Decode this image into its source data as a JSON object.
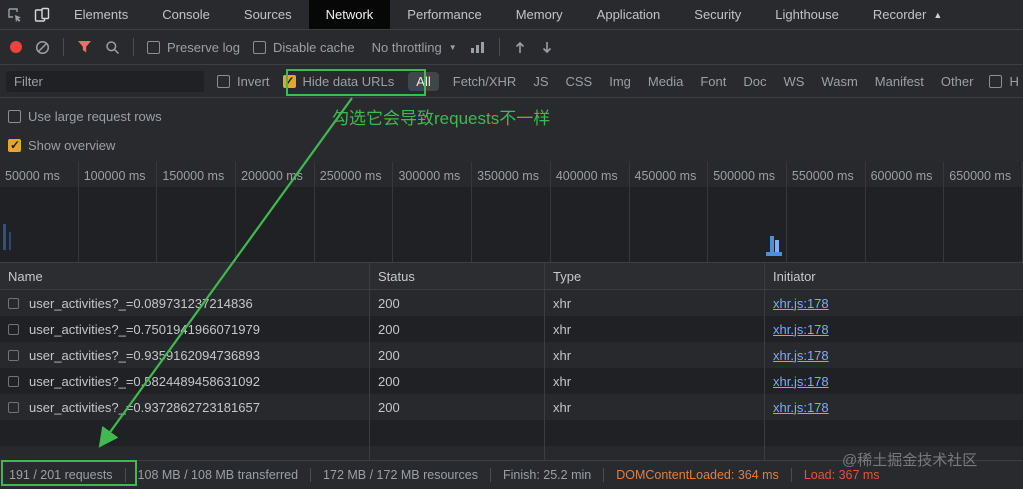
{
  "colors": {
    "accent_green": "#3fb950",
    "link_blue": "#7cacf8",
    "checkbox_orange": "#e3a82b",
    "record_red": "#ef4337",
    "funnel_pink": "#e57368",
    "dcl_orange": "#dd8140",
    "load_red": "#e5533c"
  },
  "tabbar": {
    "active": "Network",
    "tabs": [
      {
        "label": "Elements"
      },
      {
        "label": "Console"
      },
      {
        "label": "Sources"
      },
      {
        "label": "Network"
      },
      {
        "label": "Performance"
      },
      {
        "label": "Memory"
      },
      {
        "label": "Application"
      },
      {
        "label": "Security"
      },
      {
        "label": "Lighthouse"
      },
      {
        "label": "Recorder",
        "arrow": "▲"
      }
    ]
  },
  "toolbar": {
    "preserve_log": "Preserve log",
    "disable_cache": "Disable cache",
    "throttling_value": "No throttling",
    "dropdown_arrow": "▼"
  },
  "filterbar": {
    "filter_placeholder": "Filter",
    "invert_label": "Invert",
    "hide_data_urls_label": "Hide data URLs",
    "active_pill": "All",
    "pills": [
      "All",
      "Fetch/XHR",
      "JS",
      "CSS",
      "Img",
      "Media",
      "Font",
      "Doc",
      "WS",
      "Wasm",
      "Manifest",
      "Other"
    ],
    "clipped_label": "H"
  },
  "options": {
    "use_large_request_rows": "Use large request rows",
    "show_overview": "Show overview"
  },
  "overview": {
    "ticks": [
      "50000 ms",
      "100000 ms",
      "150000 ms",
      "200000 ms",
      "250000 ms",
      "300000 ms",
      "350000 ms",
      "400000 ms",
      "450000 ms",
      "500000 ms",
      "550000 ms",
      "600000 ms",
      "650000 ms"
    ]
  },
  "table": {
    "columns": [
      "Name",
      "Status",
      "Type",
      "Initiator"
    ],
    "rows": [
      {
        "name": "user_activities?_=0.089731237214836",
        "status": "200",
        "type": "xhr",
        "initiator": "xhr.js:178"
      },
      {
        "name": "user_activities?_=0.7501941966071979",
        "status": "200",
        "type": "xhr",
        "initiator": "xhr.js:178"
      },
      {
        "name": "user_activities?_=0.9359162094736893",
        "status": "200",
        "type": "xhr",
        "initiator": "xhr.js:178"
      },
      {
        "name": "user_activities?_=0.5824489458631092",
        "status": "200",
        "type": "xhr",
        "initiator": "xhr.js:178"
      },
      {
        "name": "user_activities?_=0.9372862723181657",
        "status": "200",
        "type": "xhr",
        "initiator": "xhr.js:178"
      }
    ]
  },
  "statusbar": {
    "requests": "191 / 201 requests",
    "transferred": "108 MB / 108 MB transferred",
    "resources": "172 MB / 172 MB resources",
    "finish": "Finish: 25.2 min",
    "dom_content_loaded": "DOMContentLoaded: 364 ms",
    "load": "Load: 367 ms"
  },
  "annotations": {
    "note": "勾选它会导致requests不一样",
    "watermark": "@稀土掘金技术社区"
  }
}
